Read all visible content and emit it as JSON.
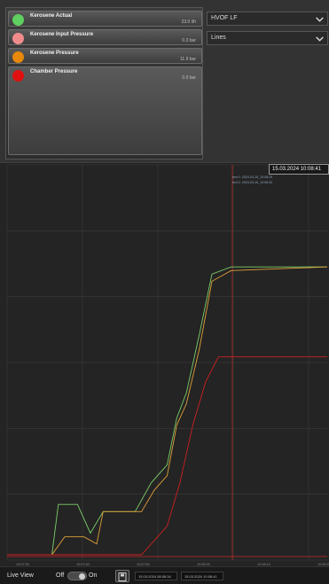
{
  "legend": [
    {
      "name": "Kerosene Actual",
      "value": "23.0 l/h",
      "color": "#5fcf5f"
    },
    {
      "name": "Kerosene Input Pressure",
      "value": "0.3 bar",
      "color": "#f08c8c"
    },
    {
      "name": "Kerosene Pressure",
      "value": "11.9 bar",
      "color": "#e8890a"
    },
    {
      "name": "Chamber Pressure",
      "value": "0.0 bar",
      "color": "#e01010"
    }
  ],
  "selects": {
    "process": "HVOF LF",
    "mode": "Lines"
  },
  "chart": {
    "timestamp": "15.03.2024 10:08:41",
    "cursor1": "text 1: 2024-03-15_10:08:29",
    "cursor2": "text 2: 2024-03-15_10:08:32",
    "x_ticks": [
      "10:07:30",
      "10:07:40",
      "10:07:50",
      "10:08:00",
      "10:08:10",
      "10:08:20"
    ],
    "line_colors": [
      "#7ccf6a",
      "#e0a03a",
      "#cc2020",
      "#a07a30"
    ],
    "cursor_color": "#b02828"
  },
  "chart_data": {
    "type": "line",
    "title": "",
    "x_ticks": [
      "10:07:30",
      "10:07:40",
      "10:07:50",
      "10:08:00",
      "10:08:10",
      "10:08:20"
    ],
    "series": [
      {
        "color": "#7ccf6a",
        "x": [
          0,
          0.14,
          0.16,
          0.22,
          0.26,
          0.3,
          0.4,
          0.45,
          0.5,
          0.53,
          0.56,
          0.6,
          0.64,
          0.7,
          1.0
        ],
        "y": [
          0,
          0,
          0.14,
          0.14,
          0.06,
          0.12,
          0.12,
          0.2,
          0.25,
          0.38,
          0.45,
          0.61,
          0.78,
          0.8,
          0.8
        ]
      },
      {
        "color": "#e0a03a",
        "x": [
          0,
          0.14,
          0.18,
          0.24,
          0.28,
          0.3,
          0.42,
          0.46,
          0.5,
          0.53,
          0.56,
          0.6,
          0.64,
          0.7,
          1.0
        ],
        "y": [
          0,
          0,
          0.05,
          0.05,
          0.03,
          0.12,
          0.12,
          0.18,
          0.22,
          0.36,
          0.42,
          0.57,
          0.76,
          0.79,
          0.8
        ]
      },
      {
        "color": "#cc2020",
        "x": [
          0,
          0.25,
          0.42,
          0.46,
          0.5,
          0.54,
          0.58,
          0.62,
          0.66,
          1.0
        ],
        "y": [
          0,
          0,
          0,
          0.04,
          0.08,
          0.2,
          0.36,
          0.48,
          0.55,
          0.55
        ]
      }
    ]
  },
  "bottom": {
    "live_view": "Live View",
    "off": "Off",
    "on": "On",
    "range_start": "15.03.2024 08:08:34",
    "range_end": "15.03.2024 10:08:41"
  }
}
